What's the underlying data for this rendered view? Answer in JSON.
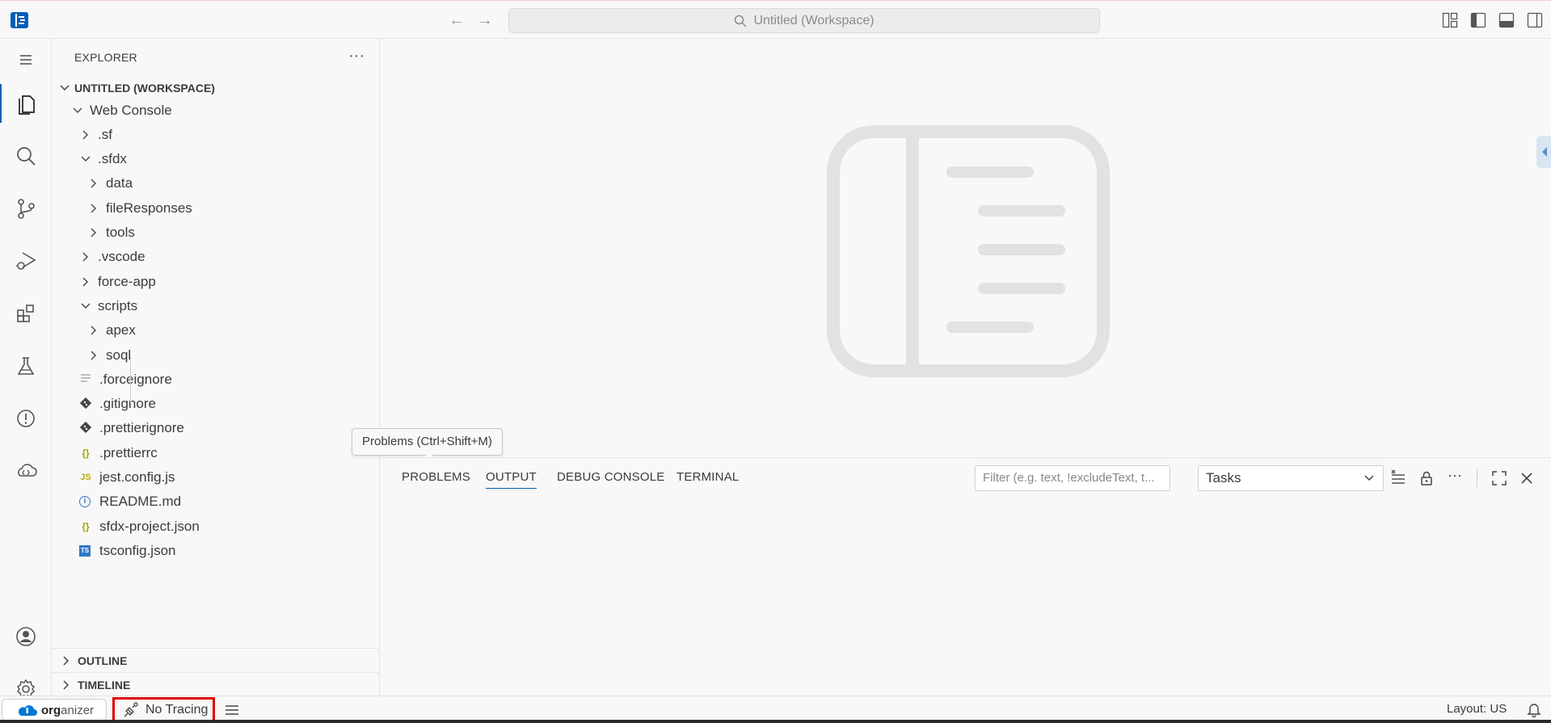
{
  "titlebar": {
    "back_glyph": "←",
    "forward_glyph": "→",
    "command_center": "Untitled (Workspace)"
  },
  "explorer": {
    "title": "EXPLORER",
    "more": "···",
    "workspace": "UNTITLED (WORKSPACE)",
    "tree": [
      {
        "label": "Web Console",
        "type": "folder-open",
        "indent": 0
      },
      {
        "label": ".sf",
        "type": "folder",
        "indent": 1
      },
      {
        "label": ".sfdx",
        "type": "folder-open",
        "indent": 1
      },
      {
        "label": "data",
        "type": "folder",
        "indent": 2
      },
      {
        "label": "fileResponses",
        "type": "folder",
        "indent": 2
      },
      {
        "label": "tools",
        "type": "folder",
        "indent": 2
      },
      {
        "label": ".vscode",
        "type": "folder",
        "indent": 1
      },
      {
        "label": "force-app",
        "type": "folder",
        "indent": 1
      },
      {
        "label": "scripts",
        "type": "folder-open",
        "indent": 1
      },
      {
        "label": "apex",
        "type": "folder",
        "indent": 2
      },
      {
        "label": "soql",
        "type": "folder",
        "indent": 2
      },
      {
        "label": ".forceignore",
        "type": "file",
        "icon": "lines-icon",
        "indent": 1
      },
      {
        "label": ".gitignore",
        "type": "file",
        "icon": "git-icon",
        "indent": 1
      },
      {
        "label": ".prettierignore",
        "type": "file",
        "icon": "git-icon",
        "indent": 1
      },
      {
        "label": ".prettierrc",
        "type": "file",
        "icon": "braces-icon",
        "indent": 1
      },
      {
        "label": "jest.config.js",
        "type": "file",
        "icon": "js-icon",
        "indent": 1
      },
      {
        "label": "README.md",
        "type": "file",
        "icon": "info-icon",
        "indent": 1
      },
      {
        "label": "sfdx-project.json",
        "type": "file",
        "icon": "braces-icon",
        "indent": 1
      },
      {
        "label": "tsconfig.json",
        "type": "file",
        "icon": "ts-icon",
        "indent": 1
      }
    ],
    "file_glyphs": {
      "braces": "{}",
      "js": "JS",
      "ts": "TS",
      "info": "i"
    },
    "outline": "OUTLINE",
    "timeline": "TIMELINE"
  },
  "tooltip": "Problems (Ctrl+Shift+M)",
  "panel": {
    "tabs": [
      "PROBLEMS",
      "OUTPUT",
      "DEBUG CONSOLE",
      "TERMINAL"
    ],
    "active_tab": "OUTPUT",
    "filter_placeholder": "Filter (e.g. text, !excludeText, t...",
    "channel": "Tasks",
    "more": "···"
  },
  "statusbar": {
    "org_bold": "org",
    "org_rest": "anizer",
    "tracing": "No Tracing",
    "layout": "Layout: US"
  },
  "colors": {
    "accent": "#005fb8",
    "highlight_box": "#e00000",
    "json_icon": "#a6a000",
    "js_icon": "#b8b000",
    "ts_icon": "#3178c6",
    "info_icon": "#3a78c3"
  }
}
